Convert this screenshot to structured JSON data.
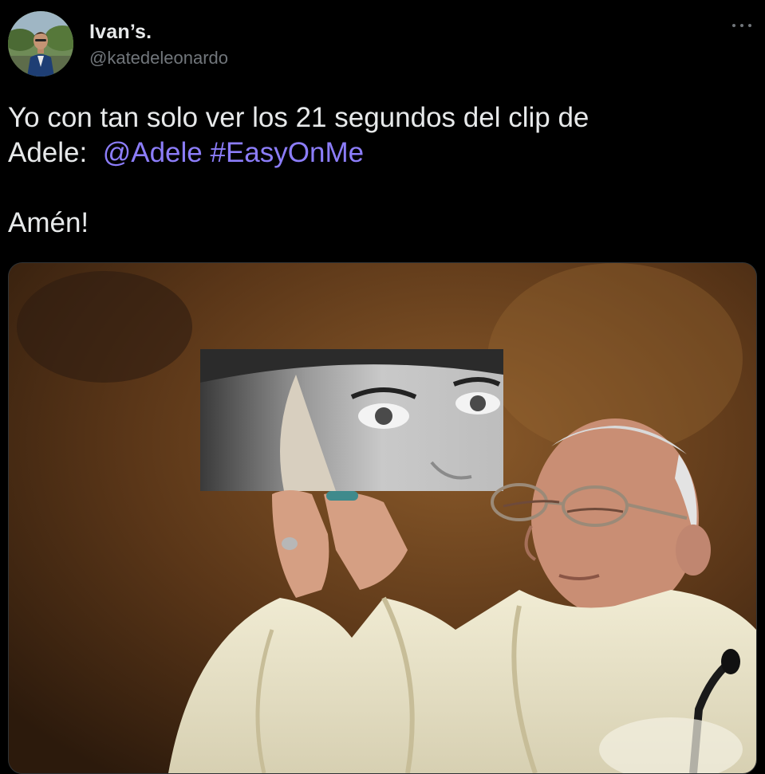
{
  "tweet": {
    "author": {
      "display_name": "Ivan’s.",
      "handle": "@katedeleonardo",
      "avatar_icon": "user-avatar-photo"
    },
    "more_icon": "more-horizontal-icon",
    "text": {
      "line1": "Yo con tan solo ver los 21 segundos del clip de",
      "line2_prefix": "Adele:  ",
      "mention": "@Adele",
      "space": " ",
      "hashtag": "#EasyOnMe",
      "line3": "Amén!"
    },
    "media": {
      "kind": "photo",
      "icon": "meme-photo"
    }
  },
  "colors": {
    "background": "#000000",
    "text": "#e7e9ea",
    "secondary": "#71767b",
    "link": "#8c7dfa",
    "border": "#2f3336"
  }
}
